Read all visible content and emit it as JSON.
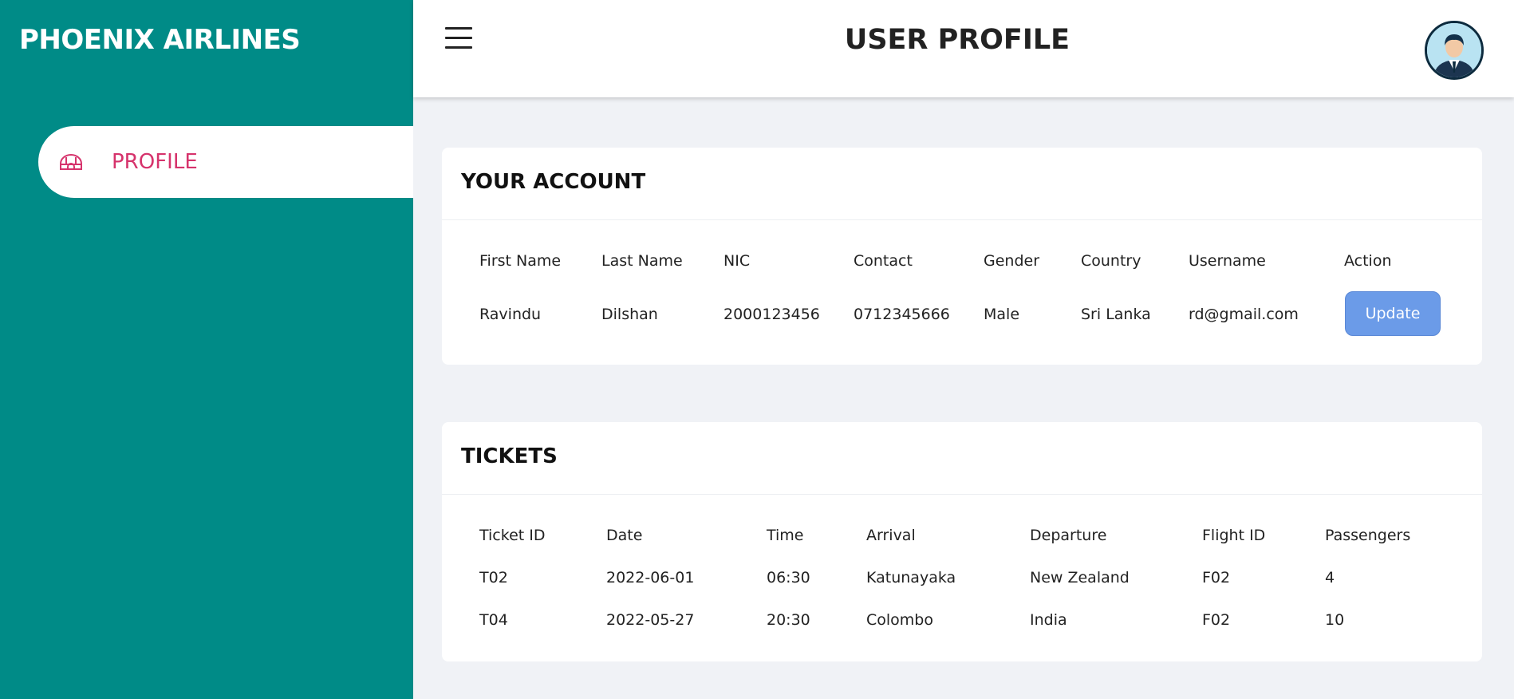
{
  "sidebar": {
    "brand": "PHOENIX AIRLINES",
    "items": [
      {
        "label": "PROFILE",
        "icon": "igloo-icon",
        "active": true
      }
    ]
  },
  "header": {
    "title": "USER PROFILE",
    "menu_icon": "hamburger-menu-icon",
    "avatar_icon": "user-avatar-icon"
  },
  "account": {
    "title": "YOUR ACCOUNT",
    "columns": [
      "First Name",
      "Last Name",
      "NIC",
      "Contact",
      "Gender",
      "Country",
      "Username",
      "Action"
    ],
    "row": [
      "Ravindu",
      "Dilshan",
      "2000123456",
      "0712345666",
      "Male",
      "Sri Lanka",
      "rd@gmail.com"
    ],
    "update_label": "Update"
  },
  "tickets": {
    "title": "TICKETS",
    "columns": [
      "Ticket ID",
      "Date",
      "Time",
      "Arrival",
      "Departure",
      "Flight ID",
      "Passengers"
    ],
    "rows": [
      [
        "T02",
        "2022-06-01",
        "06:30",
        "Katunayaka",
        "New Zealand",
        "F02",
        "4"
      ],
      [
        "T04",
        "2022-05-27",
        "20:30",
        "Colombo",
        "India",
        "F02",
        "10"
      ]
    ]
  },
  "colors": {
    "sidebar_bg": "#008b87",
    "active_label": "#d6336c",
    "button_bg": "#6b9be8",
    "content_bg": "#f0f2f6"
  }
}
